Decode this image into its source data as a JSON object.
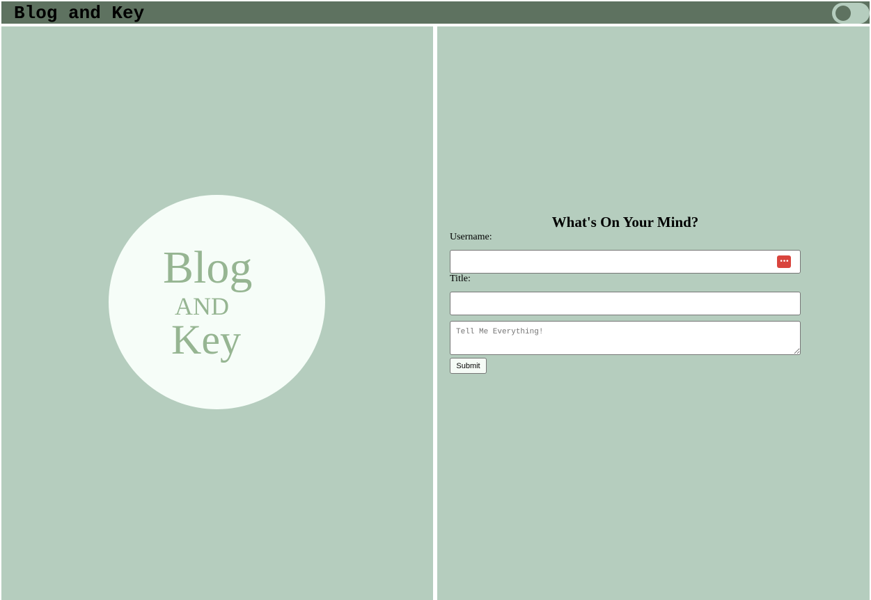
{
  "header": {
    "title": "Blog and Key",
    "theme_toggle": "off"
  },
  "logo": {
    "line1": "Blog",
    "line2": "AND",
    "line3": "Key"
  },
  "form": {
    "heading": "What's On Your Mind?",
    "username_label": "Username:",
    "username_value": "",
    "title_label": "Title:",
    "title_value": "",
    "message_placeholder": "Tell Me Everything!",
    "submit_label": "Submit",
    "password_manager_icon": "key-dots-icon"
  },
  "colors": {
    "header_bg": "#5e7260",
    "panel_bg": "#b5cdbe",
    "logo_circle": "#f6fdf8",
    "logo_text": "#96b592",
    "password_icon": "#d9443d"
  }
}
